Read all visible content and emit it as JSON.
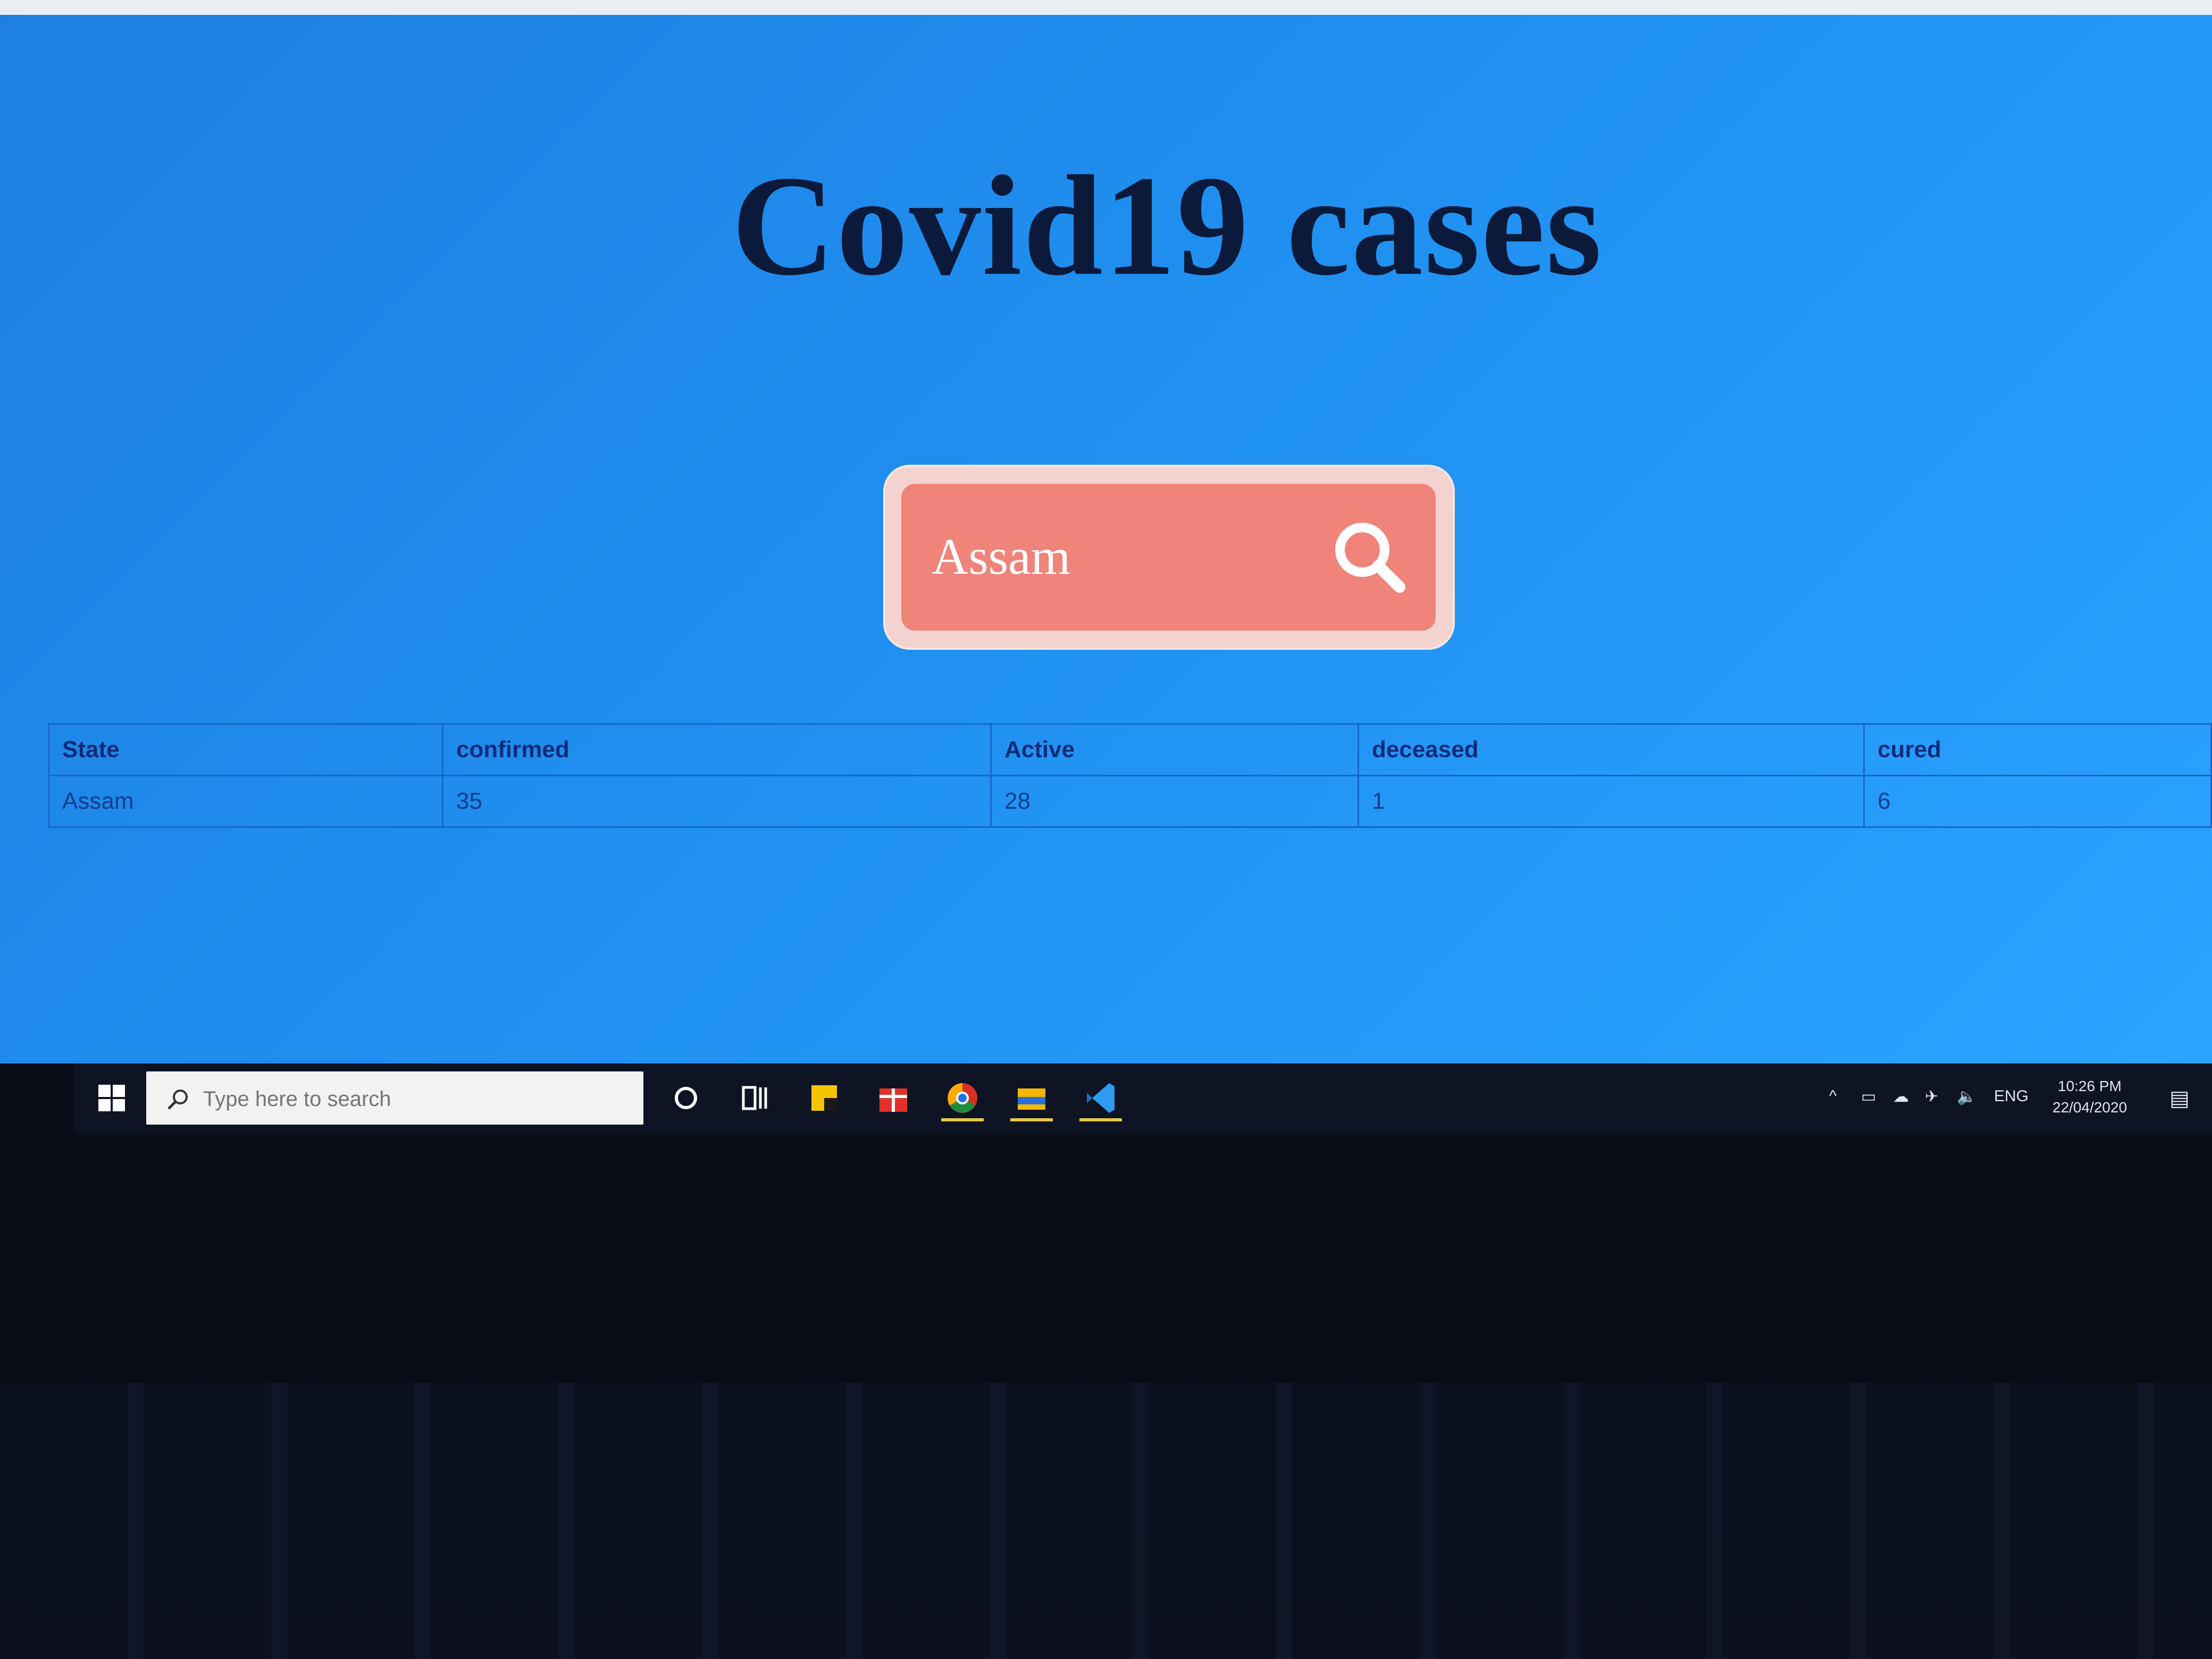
{
  "page": {
    "title": "Covid19 cases",
    "search": {
      "value": "Assam",
      "icon": "search-icon"
    },
    "table": {
      "headers": [
        "State",
        "confirmed",
        "Active",
        "deceased",
        "cured"
      ],
      "rows": [
        [
          "Assam",
          "35",
          "28",
          "1",
          "6"
        ]
      ]
    }
  },
  "taskbar": {
    "search_placeholder": "Type here to search",
    "apps": [
      "cortana-icon",
      "task-view-icon",
      "sticky-notes-icon",
      "gift-icon",
      "chrome-icon",
      "file-explorer-icon",
      "vscode-icon"
    ],
    "tray": {
      "language": "ENG",
      "time": "10:26 PM",
      "date": "22/04/2020"
    }
  },
  "colors": {
    "background": "#1f8ff0",
    "title": "#0b1a3a",
    "search_box": "#f0837a",
    "table_border": "#1967c4"
  }
}
